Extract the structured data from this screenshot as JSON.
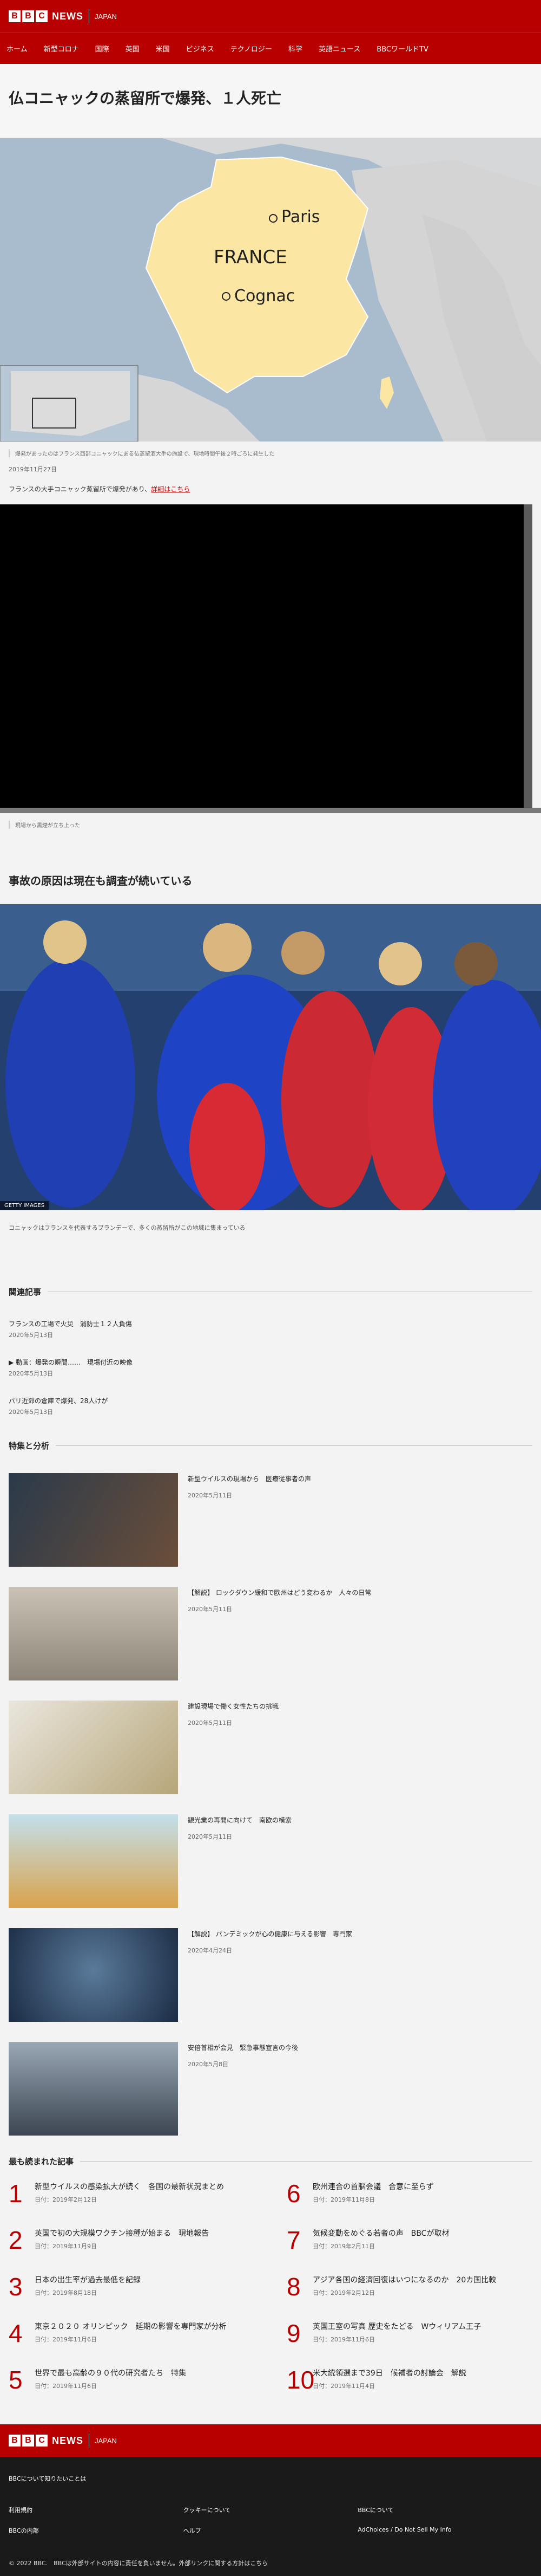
{
  "header": {
    "logo_letters": [
      "B",
      "B",
      "C"
    ],
    "news": "NEWS",
    "edition": "JAPAN"
  },
  "nav": [
    "ホーム",
    "新型コロナ",
    "国際",
    "英国",
    "米国",
    "ビジネス",
    "テクノロジー",
    "科学",
    "英語ニュース",
    "BBCワールドTV"
  ],
  "article": {
    "headline": "仏コニャックの蒸留所で爆発、１人死亡",
    "map": {
      "label_country": "FRANCE",
      "label_paris": "Paris",
      "label_cognac": "Cognac"
    },
    "map_caption": "爆発があったのはフランス西部コニャックにある仏蒸留酒大手の施設で、現地時間午後２時ごろに発生した",
    "date": "2019年11月27日",
    "intro": "フランスの大手コニャック蒸留所で爆発があり、",
    "intro_link": "詳細はこちら",
    "video_caption": "現場から黒煙が立ち上った",
    "section2": "事故の原因は現在も調査が続いている",
    "photo_label": "GETTY IMAGES",
    "photo_caption": "コニャックはフランスを代表するブランデーで、多くの蒸留所がこの地域に集まっている"
  },
  "related": {
    "title": "関連記事",
    "items": [
      {
        "title": "フランスの工場で火災　消防士１２人負傷",
        "date": "2020年5月13日"
      },
      {
        "title": "▶ 動画：爆発の瞬間……　現場付近の映像",
        "date": "2020年5月13日"
      },
      {
        "title": "パリ近郊の倉庫で爆発、28人けが",
        "date": "2020年5月13日"
      }
    ]
  },
  "features": {
    "title": "特集と分析",
    "items": [
      {
        "title": "新型ウイルスの現場から　医療従事者の声",
        "date": "2020年5月11日"
      },
      {
        "title": "【解説】 ロックダウン緩和で欧州はどう変わるか　人々の日常",
        "date": "2020年5月11日"
      },
      {
        "title": "建設現場で働く女性たちの挑戦",
        "date": "2020年5月11日"
      },
      {
        "title": "観光業の再開に向けて　南欧の模索",
        "date": "2020年5月11日"
      },
      {
        "title": "【解説】 パンデミックが心の健康に与える影響　専門家",
        "date": "2020年4月24日"
      },
      {
        "title": "安倍首相が会見　緊急事態宣言の今後",
        "date": "2020年5月8日"
      }
    ]
  },
  "most_read": {
    "title": "最も読まれた記事",
    "label": "日付：",
    "items": [
      {
        "n": "1",
        "title": "新型ウイルスの感染拡大が続く　各国の最新状況まとめ",
        "date": "2019年2月12日"
      },
      {
        "n": "2",
        "title": "英国で初の大規模ワクチン接種が始まる　現地報告",
        "date": "2019年11月9日"
      },
      {
        "n": "3",
        "title": "日本の出生率が過去最低を記録",
        "date": "2019年8月18日"
      },
      {
        "n": "4",
        "title": "東京２０２０ オリンピック　延期の影響を専門家が分析",
        "date": "2019年11月6日"
      },
      {
        "n": "5",
        "title": "世界で最も高齢の９０代の研究者たち　特集",
        "date": "2019年11月6日"
      },
      {
        "n": "6",
        "title": "欧州連合の首脳会議　合意に至らず",
        "date": "2019年11月8日"
      },
      {
        "n": "7",
        "title": "気候変動をめぐる若者の声　BBCが取材",
        "date": "2019年2月11日"
      },
      {
        "n": "8",
        "title": "アジア各国の経済回復はいつになるのか　20カ国比較",
        "date": "2019年2月12日"
      },
      {
        "n": "9",
        "title": "英国王室の写真 歴史をたどる　Wウィリアム王子",
        "date": "2019年11月6日"
      },
      {
        "n": "10",
        "title": "米大統領選まで39日　候補者の討論会　解説",
        "date": "2019年11月4日"
      }
    ]
  },
  "footer": {
    "brand": "BBCについて知りたいことは",
    "links": [
      "利用規約",
      "クッキーについて",
      "BBCについて",
      "BBCの内部",
      "ヘルプ",
      "AdChoices / Do Not Sell My Info"
    ],
    "copyright": "© 2022 BBC.　BBCは外部サイトの内容に責任を負いません。外部リンクに関する方針はこちら"
  }
}
